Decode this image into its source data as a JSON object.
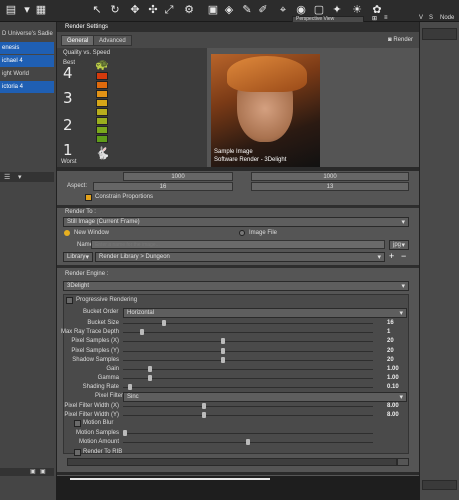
{
  "topbar": {
    "perspective_view": "Perspective View",
    "node_label": "Node"
  },
  "scene": {
    "items": [
      {
        "label": "D Universe's Sadie",
        "selected": false
      },
      {
        "label": "enesis",
        "selected": true
      },
      {
        "label": "ichael 4",
        "selected": true
      },
      {
        "label": "ight World",
        "selected": false
      },
      {
        "label": "ictoria 4",
        "selected": true
      }
    ]
  },
  "window": {
    "title": "Render Settings",
    "tabs": [
      "General",
      "Advanced"
    ],
    "render_button": "Render",
    "quality_label": "Quality vs. Speed",
    "best": "Best",
    "worst": "Worst",
    "levels": [
      "4",
      "3",
      "2",
      "1"
    ],
    "preview_caption_1": "Sample Image",
    "preview_caption_2": "Software Render - 3Delight",
    "aspect_label": "Aspect:",
    "aspect_w": "16",
    "aspect_h": "13",
    "width_value": "1000",
    "height_value": "1000",
    "constrain": "Constrain Proportions",
    "render_to_label": "Render To :",
    "render_to_value": "Still Image (Current Frame)",
    "new_window": "New Window",
    "image_file": "Image File",
    "name_label": "Name",
    "name_placeholder": "Enter a name for the image...",
    "ext_value": "jpg",
    "library_value": "Library",
    "library_path": "Render Library > Dungeon",
    "engine_label": "Render Engine :",
    "engine_value": "3Delight",
    "progressive": "Progressive Rendering",
    "bucket_order_label": "Bucket Order",
    "bucket_order_value": "Horizontal",
    "pixel_filter_label": "Pixel Filter",
    "pixel_filter_value": "Sinc",
    "motion_blur": "Motion Blur",
    "render_to_rib": "Render To RIB"
  },
  "sliders": [
    {
      "label": "Bucket Size",
      "value": "16",
      "pos": 0.16
    },
    {
      "label": "Max Ray Trace Depth",
      "value": "1",
      "pos": 0.07
    },
    {
      "label": "Pixel Samples (X)",
      "value": "20",
      "pos": 0.4
    },
    {
      "label": "Pixel Samples (Y)",
      "value": "20",
      "pos": 0.4
    },
    {
      "label": "Shadow Samples",
      "value": "20",
      "pos": 0.4
    },
    {
      "label": "Gain",
      "value": "1.00",
      "pos": 0.1
    },
    {
      "label": "Gamma",
      "value": "1.00",
      "pos": 0.1
    },
    {
      "label": "Shading Rate",
      "value": "0.10",
      "pos": 0.02
    }
  ],
  "sliders2": [
    {
      "label": "Pixel Filter Width (X)",
      "value": "8.00",
      "pos": 0.32
    },
    {
      "label": "Pixel Filter Width (Y)",
      "value": "8.00",
      "pos": 0.32
    }
  ],
  "sliders3": [
    {
      "label": "Motion Samples",
      "value": "",
      "pos": 0.0
    },
    {
      "label": "Motion Amount",
      "value": "",
      "pos": 0.5
    }
  ]
}
